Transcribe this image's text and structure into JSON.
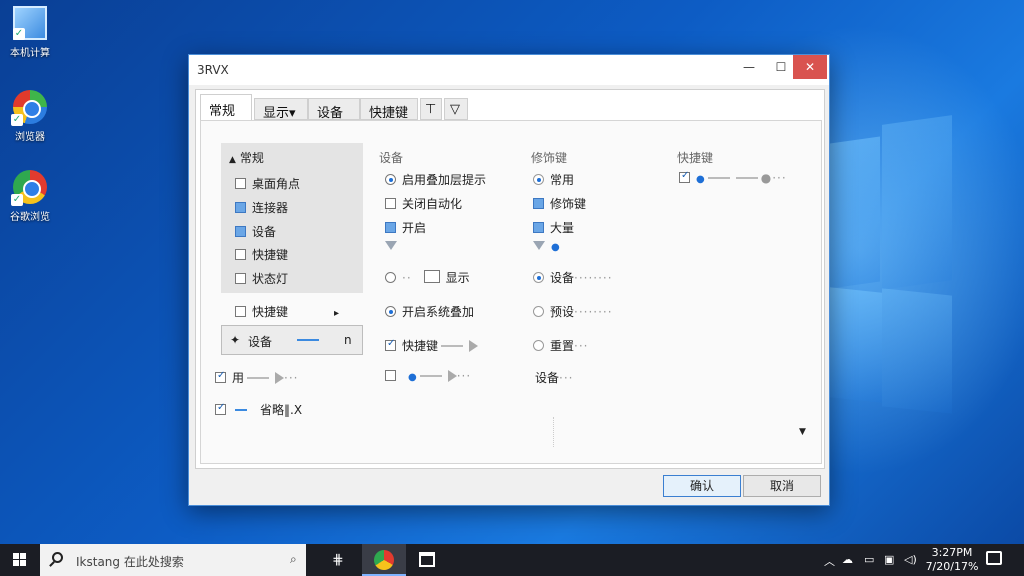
{
  "desktop": {
    "icons": [
      {
        "label": "本机计算"
      },
      {
        "label": "浏览器"
      },
      {
        "label": "谷歌浏览"
      }
    ]
  },
  "window": {
    "title": "3RVX",
    "controls": {
      "min": "—",
      "max": "☐",
      "close": "✕"
    },
    "tabs": [
      {
        "label": "常规"
      },
      {
        "label": "显示▾"
      },
      {
        "label": "设备"
      },
      {
        "label": "快捷键"
      },
      {
        "label": "⊤"
      },
      {
        "label": "▽"
      }
    ],
    "left_tree": {
      "header": "常规",
      "items": [
        {
          "label": "桌面角点"
        },
        {
          "label": "连接器"
        },
        {
          "label": "设备"
        },
        {
          "label": "快捷键"
        },
        {
          "label": "状态灯"
        },
        {
          "label": "快捷键",
          "arrow": "▸"
        }
      ]
    },
    "combo": {
      "label": "设备",
      "suffix": "n"
    },
    "left_extra": [
      {
        "label": "用"
      },
      {
        "label": "省略‖.X"
      }
    ],
    "columns": [
      {
        "header": "设备"
      },
      {
        "header": "修饰键"
      },
      {
        "header": "快捷键"
      }
    ],
    "col1": [
      {
        "label": "启用叠加层提示"
      },
      {
        "label": "关闭自动化"
      },
      {
        "label": "开启"
      },
      {
        "label": "显示"
      },
      {
        "label": "开启系统叠加"
      },
      {
        "label": "快捷键"
      }
    ],
    "col2": [
      {
        "label": "常用"
      },
      {
        "label": "修饰键"
      },
      {
        "label": "大量"
      },
      {
        "label": "设备"
      },
      {
        "label": "设备"
      },
      {
        "label": "预设"
      },
      {
        "label": "重置"
      }
    ],
    "buttons": {
      "ok": "确认",
      "cancel": "取消"
    }
  },
  "taskbar": {
    "search_placeholder": "Ikstang 在此处搜索",
    "clock_time": "3:27PM",
    "clock_date": "7/20/17%"
  }
}
